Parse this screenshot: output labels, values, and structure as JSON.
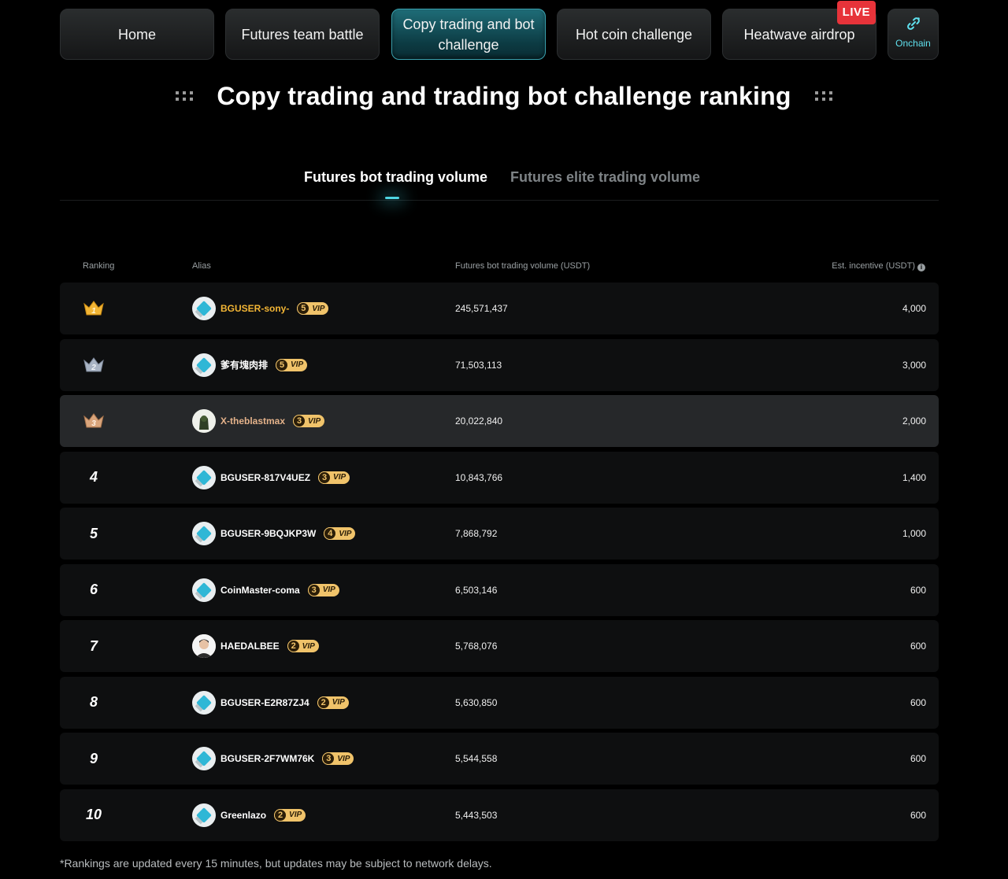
{
  "nav": {
    "items": [
      {
        "label": "Home"
      },
      {
        "label": "Futures team battle"
      },
      {
        "label": "Copy trading and bot challenge"
      },
      {
        "label": "Hot coin challenge"
      },
      {
        "label": "Heatwave airdrop"
      }
    ],
    "live_badge": "LIVE",
    "onchain_label": "Onchain"
  },
  "page_title": "Copy trading and trading bot challenge ranking",
  "tabs": [
    {
      "label": "Futures bot trading volume"
    },
    {
      "label": "Futures elite trading volume"
    }
  ],
  "table": {
    "headers": {
      "ranking": "Ranking",
      "alias": "Alias",
      "volume": "Futures bot trading volume (USDT)",
      "incentive": "Est. incentive (USDT)"
    },
    "vip_label": "VIP",
    "rows": [
      {
        "rank": "1",
        "alias": "BGUSER-sony-",
        "vip": "5",
        "volume": "245,571,437",
        "incentive": "4,000"
      },
      {
        "rank": "2",
        "alias": "爹有塊肉排",
        "vip": "5",
        "volume": "71,503,113",
        "incentive": "3,000"
      },
      {
        "rank": "3",
        "alias": "X-theblastmax",
        "vip": "3",
        "volume": "20,022,840",
        "incentive": "2,000"
      },
      {
        "rank": "4",
        "alias": "BGUSER-817V4UEZ",
        "vip": "3",
        "volume": "10,843,766",
        "incentive": "1,400"
      },
      {
        "rank": "5",
        "alias": "BGUSER-9BQJKP3W",
        "vip": "4",
        "volume": "7,868,792",
        "incentive": "1,000"
      },
      {
        "rank": "6",
        "alias": "CoinMaster-coma",
        "vip": "3",
        "volume": "6,503,146",
        "incentive": "600"
      },
      {
        "rank": "7",
        "alias": "HAEDALBEE",
        "vip": "2",
        "volume": "5,768,076",
        "incentive": "600"
      },
      {
        "rank": "8",
        "alias": "BGUSER-E2R87ZJ4",
        "vip": "2",
        "volume": "5,630,850",
        "incentive": "600"
      },
      {
        "rank": "9",
        "alias": "BGUSER-2F7WM76K",
        "vip": "3",
        "volume": "5,544,558",
        "incentive": "600"
      },
      {
        "rank": "10",
        "alias": "Greenlazo",
        "vip": "2",
        "volume": "5,443,503",
        "incentive": "600"
      }
    ]
  },
  "footnote": "*Rankings are updated every 15 minutes, but updates may be subject to network delays.",
  "colors": {
    "accent": "#4fd6e2",
    "gold": "#f2b535",
    "silver": "#a9b4c4",
    "bronze": "#d9a57c",
    "live": "#e7333a"
  }
}
